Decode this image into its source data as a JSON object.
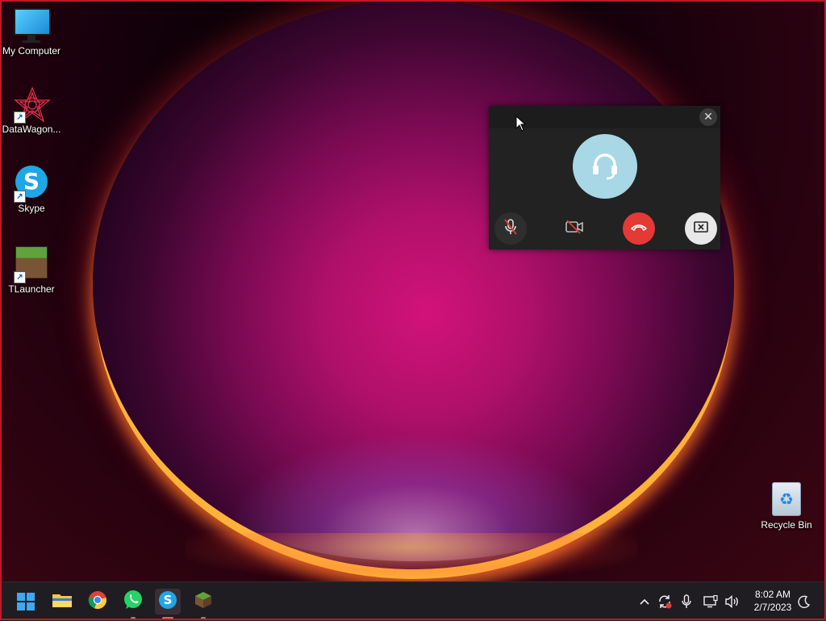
{
  "desktop": {
    "icons": [
      {
        "label": "My Computer",
        "icon": "monitor-icon"
      },
      {
        "label": "DataWagon...",
        "icon": "datawagon-icon"
      },
      {
        "label": "Skype",
        "icon": "skype-icon"
      },
      {
        "label": "TLauncher",
        "icon": "minecraft-block-icon"
      }
    ],
    "recycle_bin": {
      "label": "Recycle Bin",
      "icon": "recycle-bin-icon"
    }
  },
  "call_window": {
    "close_glyph": "✕",
    "avatar_icon": "headset-icon",
    "buttons": [
      {
        "name": "mute-microphone",
        "icon": "mic-off-icon"
      },
      {
        "name": "toggle-camera",
        "icon": "camera-off-icon"
      },
      {
        "name": "end-call",
        "icon": "phone-hangup-icon",
        "color": "#e53935"
      },
      {
        "name": "minimize-call",
        "icon": "screen-exit-icon"
      }
    ]
  },
  "taskbar": {
    "apps": [
      {
        "name": "start",
        "icon": "windows-icon"
      },
      {
        "name": "file-explorer",
        "icon": "folder-icon"
      },
      {
        "name": "chrome",
        "icon": "chrome-icon"
      },
      {
        "name": "whatsapp",
        "icon": "whatsapp-icon"
      },
      {
        "name": "skype",
        "icon": "skype-icon",
        "active": true
      },
      {
        "name": "tlauncher",
        "icon": "minecraft-block-icon"
      }
    ],
    "tray": {
      "chevron": "^",
      "time": "8:02 AM",
      "date": "2/7/2023"
    }
  },
  "colors": {
    "accent_blue": "#3ea8f5",
    "end_call_red": "#e53935",
    "skype_blue": "#1ea6e6"
  }
}
